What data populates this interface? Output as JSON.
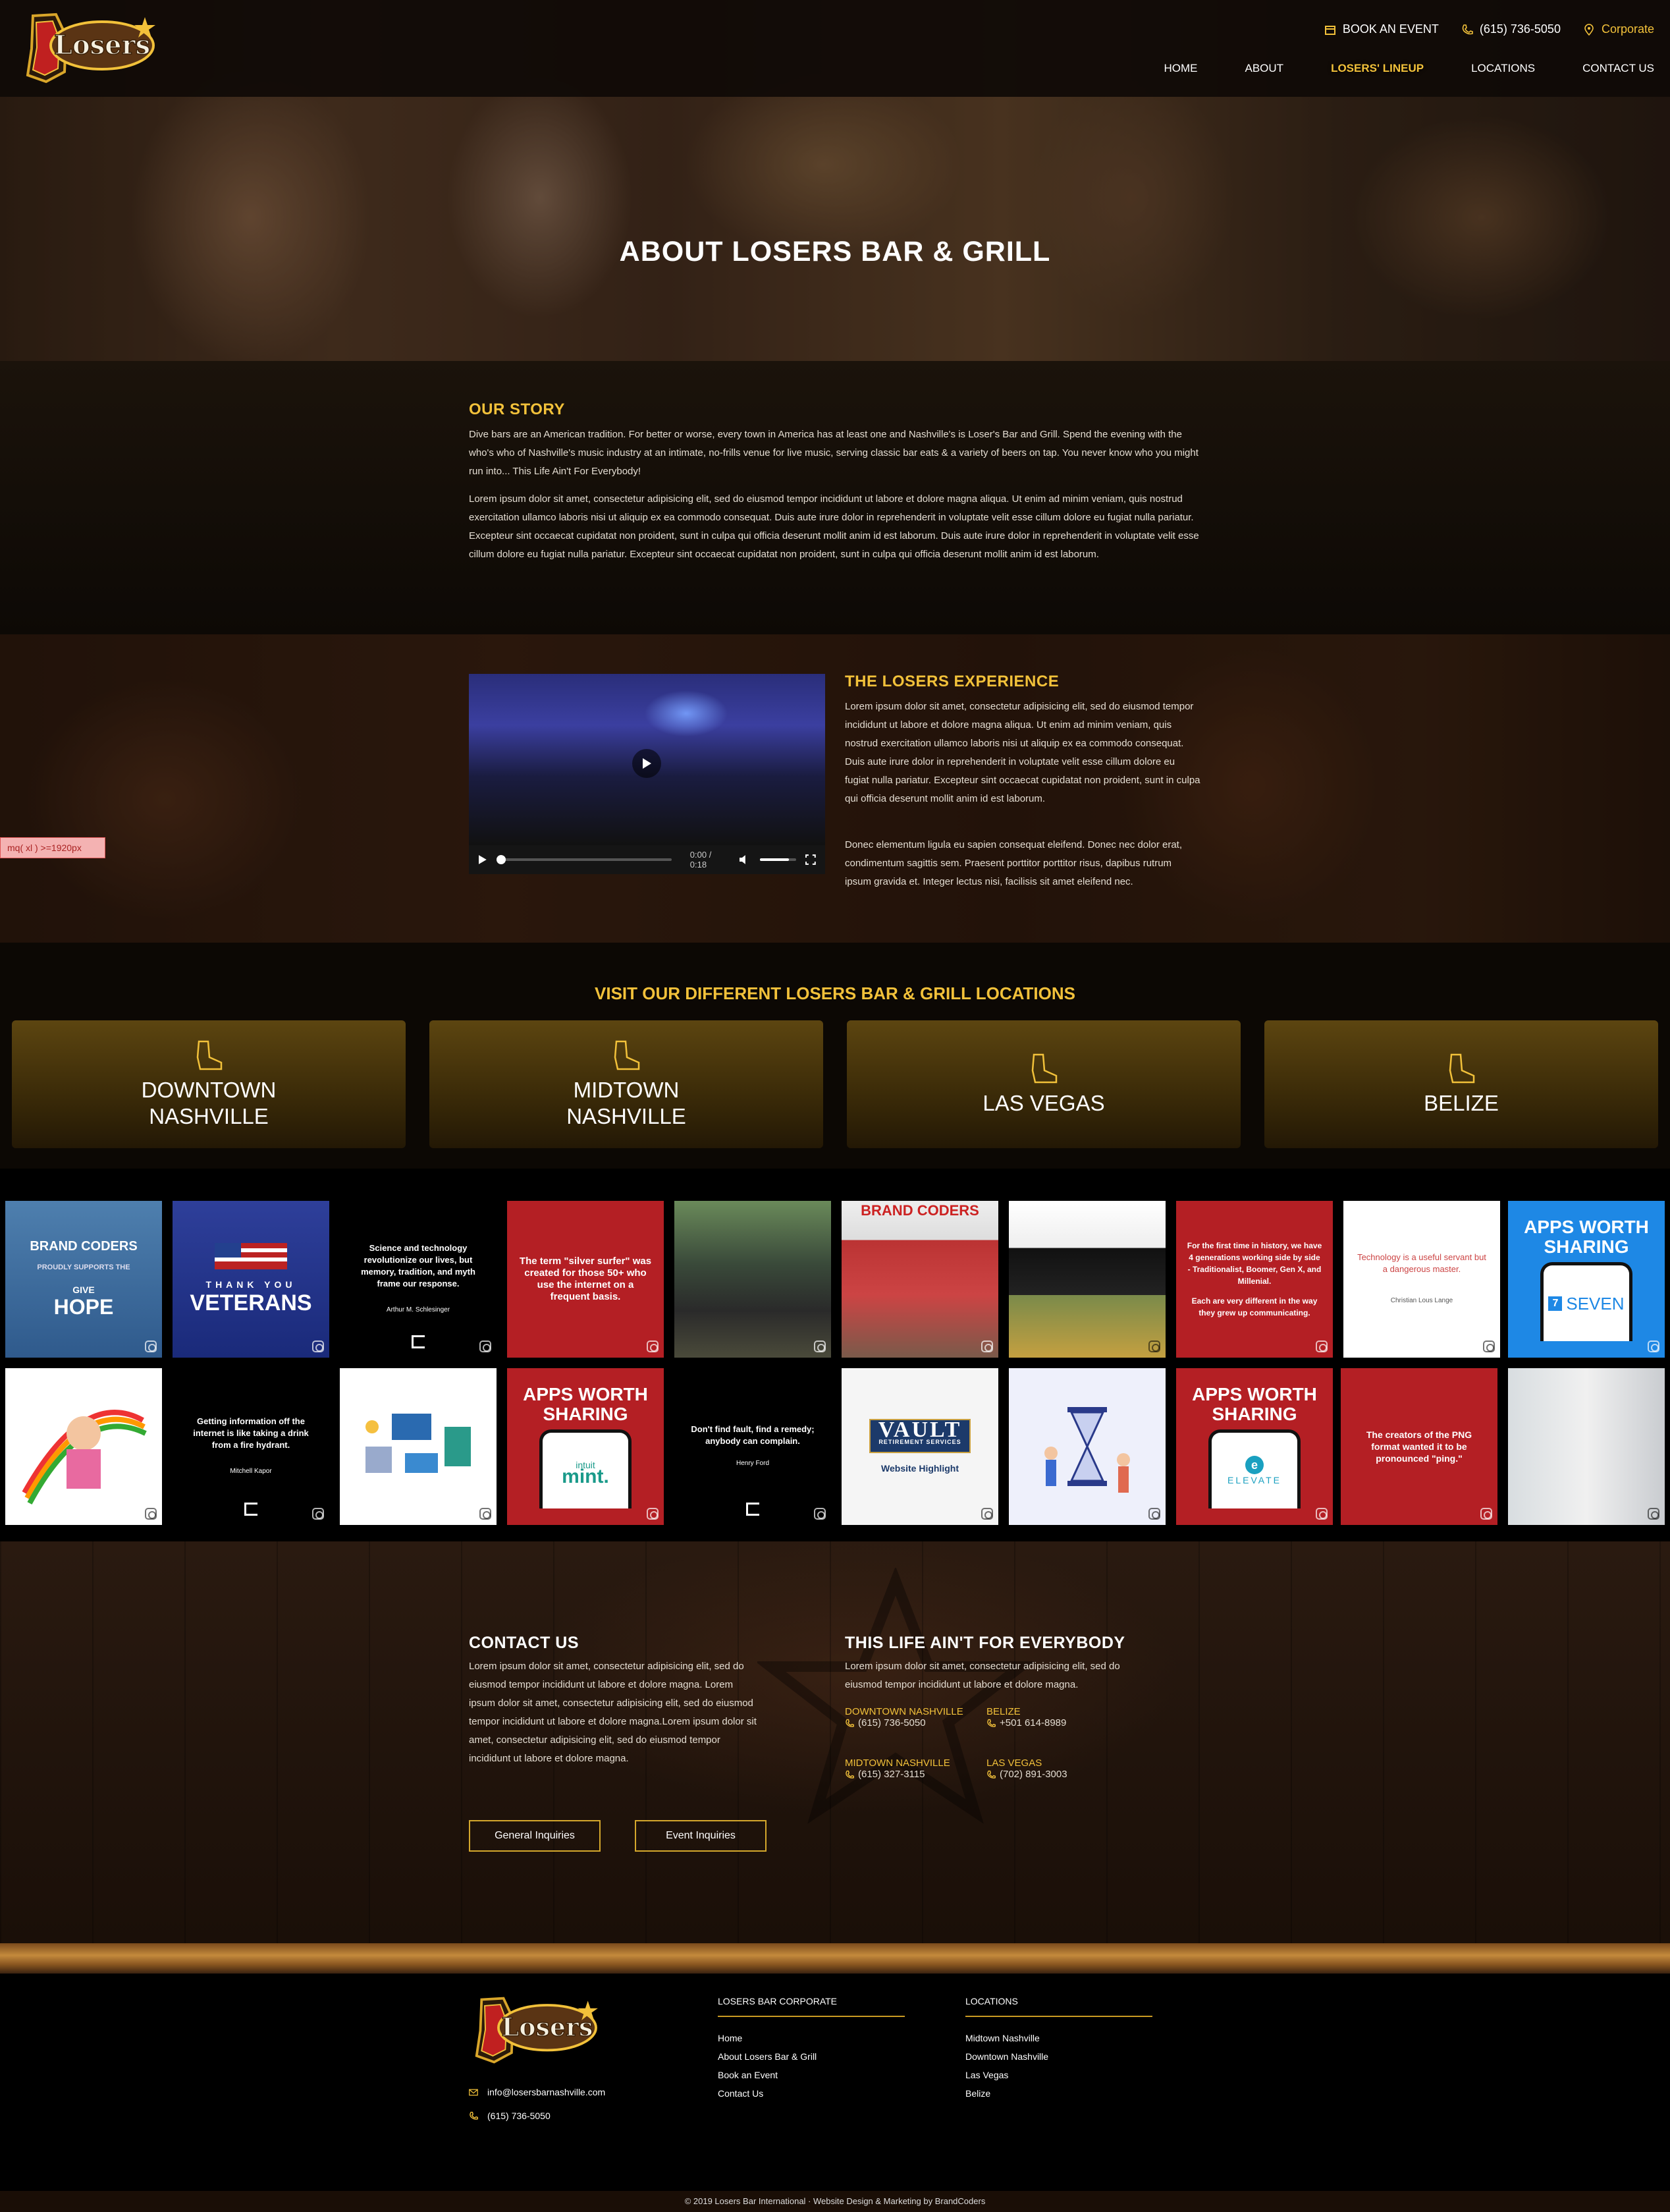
{
  "header": {
    "logo_text": "Losers",
    "topbar": {
      "book_event": "BOOK AN EVENT",
      "phone": "(615) 736-5050",
      "corporate": "Corporate"
    },
    "nav": [
      "HOME",
      "ABOUT",
      "LOSERS' LINEUP",
      "LOCATIONS",
      "CONTACT US"
    ],
    "active_nav": "LOSERS' LINEUP"
  },
  "hero": {
    "title": "ABOUT LOSERS BAR & GRILL"
  },
  "story": {
    "heading": "OUR STORY",
    "para1": "Dive bars are an American tradition. For better or worse, every town in America has at least one and Nashville's is Loser's Bar and Grill. Spend the evening with the who's who of Nashville's music industry at an intimate, no-frills venue for live music, serving classic bar eats & a variety of beers on tap. You never know who you might run into... This Life Ain't For Everybody!",
    "para2": "Lorem ipsum dolor sit amet, consectetur adipisicing elit, sed do eiusmod tempor incididunt ut labore et dolore magna aliqua. Ut enim ad minim veniam, quis nostrud exercitation ullamco laboris nisi ut aliquip ex ea commodo consequat. Duis aute irure dolor in reprehenderit in voluptate velit esse cillum dolore eu fugiat nulla pariatur. Excepteur sint occaecat cupidatat non proident, sunt in culpa qui officia deserunt mollit anim id est laborum. Duis aute irure dolor in reprehenderit in voluptate velit esse cillum dolore eu fugiat nulla pariatur. Excepteur sint occaecat cupidatat non proident, sunt in culpa qui officia deserunt mollit anim id est laborum."
  },
  "experience": {
    "heading": "THE LOSERS EXPERIENCE",
    "para1": "Lorem ipsum dolor sit amet, consectetur adipisicing elit, sed do eiusmod tempor incididunt ut labore et dolore magna aliqua. Ut enim ad minim veniam, quis nostrud exercitation ullamco laboris nisi ut aliquip ex ea commodo consequat. Duis aute irure dolor in reprehenderit in voluptate velit esse cillum dolore eu fugiat nulla pariatur. Excepteur sint occaecat cupidatat non proident, sunt in culpa qui officia deserunt mollit anim id est laborum.",
    "para2": "Donec elementum ligula eu sapien consequat eleifend. Donec nec dolor erat, condimentum sagittis sem. Praesent porttitor porttitor risus, dapibus rutrum ipsum gravida et. Integer lectus nisi, facilisis sit amet eleifend nec.",
    "video_time": "0:00 / 0:18",
    "video_progress": 0.0,
    "volume_level": 0.8,
    "debug_badge": "mq( xl ) >=1920px"
  },
  "locations": {
    "heading": "VISIT OUR DIFFERENT LOSERS BAR & GRILL LOCATIONS",
    "cards": [
      "DOWNTOWN\nNASHVILLE",
      "MIDTOWN\nNASHVILLE",
      "LAS VEGAS",
      "BELIZE"
    ]
  },
  "instagram": {
    "tiles": [
      {
        "brand": "BRAND",
        "brand2": "CODERS",
        "sub": "PROUDLY SUPPORTS THE",
        "give": "GIVE",
        "hope": "HOPE"
      },
      {
        "thank": "THANK YOU",
        "veterans": "VETERANS"
      },
      {
        "quote": "Science and technology revolutionize our lives, but memory, tradition, and myth frame our response.",
        "author": "Arthur M. Schlesinger"
      },
      {
        "text": "The term \"silver surfer\" was created for those 50+ who use the internet on a frequent basis."
      },
      {},
      {
        "brand": "BRAND",
        "brand2": "CODERS"
      },
      {},
      {
        "text": "For the first time in history, we have 4 generations working side by side - Traditionalist, Boomer, Gen X, and Millenial.",
        "text2": "Each are very different in the way they grew up communicating."
      },
      {
        "quote": "Technology is a useful servant but a dangerous master.",
        "author": "Christian Lous Lange"
      },
      {
        "apps": "APPS WORTH SHARING",
        "app": "SEVEN",
        "badge": "7"
      },
      {},
      {
        "quote": "Getting information off the internet is like taking a drink from a fire hydrant.",
        "author": "Mitchell Kapor"
      },
      {},
      {
        "apps": "APPS WORTH SHARING",
        "app1": "intuit",
        "app2": "mint."
      },
      {
        "quote": "Don't find fault, find a remedy; anybody can complain.",
        "author": "Henry Ford"
      },
      {
        "vault": "VAULT",
        "vault_sub": "RETIREMENT SERVICES",
        "caption": "Website Highlight"
      },
      {},
      {
        "apps": "APPS WORTH SHARING",
        "app": "ELEVATE",
        "badge": "e"
      },
      {
        "text": "The creators of the PNG format wanted it to be pronounced \"ping.\""
      },
      {}
    ]
  },
  "contact": {
    "heading": "CONTACT US",
    "para": "Lorem ipsum dolor sit amet, consectetur adipisicing elit, sed do eiusmod tempor incididunt ut labore et dolore magna. Lorem ipsum dolor sit amet, consectetur adipisicing elit, sed do eiusmod tempor incididunt ut labore et dolore magna.Lorem ipsum dolor sit amet, consectetur adipisicing elit, sed do eiusmod tempor incididunt ut labore et dolore magna.",
    "btn_general": "General Inquiries",
    "btn_event": "Event Inquiries",
    "life_heading": "THIS LIFE AIN'T FOR EVERYBODY",
    "life_para": "Lorem ipsum dolor sit amet, consectetur adipisicing elit, sed do eiusmod tempor incididunt ut labore et dolore magna.",
    "locs": [
      {
        "name": "DOWNTOWN NASHVILLE",
        "phone": "(615) 736-5050"
      },
      {
        "name": "BELIZE",
        "phone": "+501 614-8989"
      },
      {
        "name": "MIDTOWN NASHVILLE",
        "phone": "(615) 327-3115"
      },
      {
        "name": "LAS VEGAS",
        "phone": "(702) 891-3003"
      }
    ]
  },
  "footer": {
    "email": "info@losersbarnashville.com",
    "phone": "(615) 736-5050",
    "corporate_heading": "LOSERS BAR CORPORATE",
    "corporate_links": [
      "Home",
      "About Losers Bar & Grill",
      "Book an Event",
      "Contact Us"
    ],
    "locations_heading": "LOCATIONS",
    "location_links": [
      "Midtown Nashville",
      "Downtown Nashville",
      "Las Vegas",
      "Belize"
    ],
    "copyright": "© 2019 Losers Bar International · Website Design & Marketing by BrandCoders"
  },
  "colors": {
    "accent": "#f2c13a",
    "tile_red": "#b41f24",
    "tile_blue": "#1e88e5"
  }
}
